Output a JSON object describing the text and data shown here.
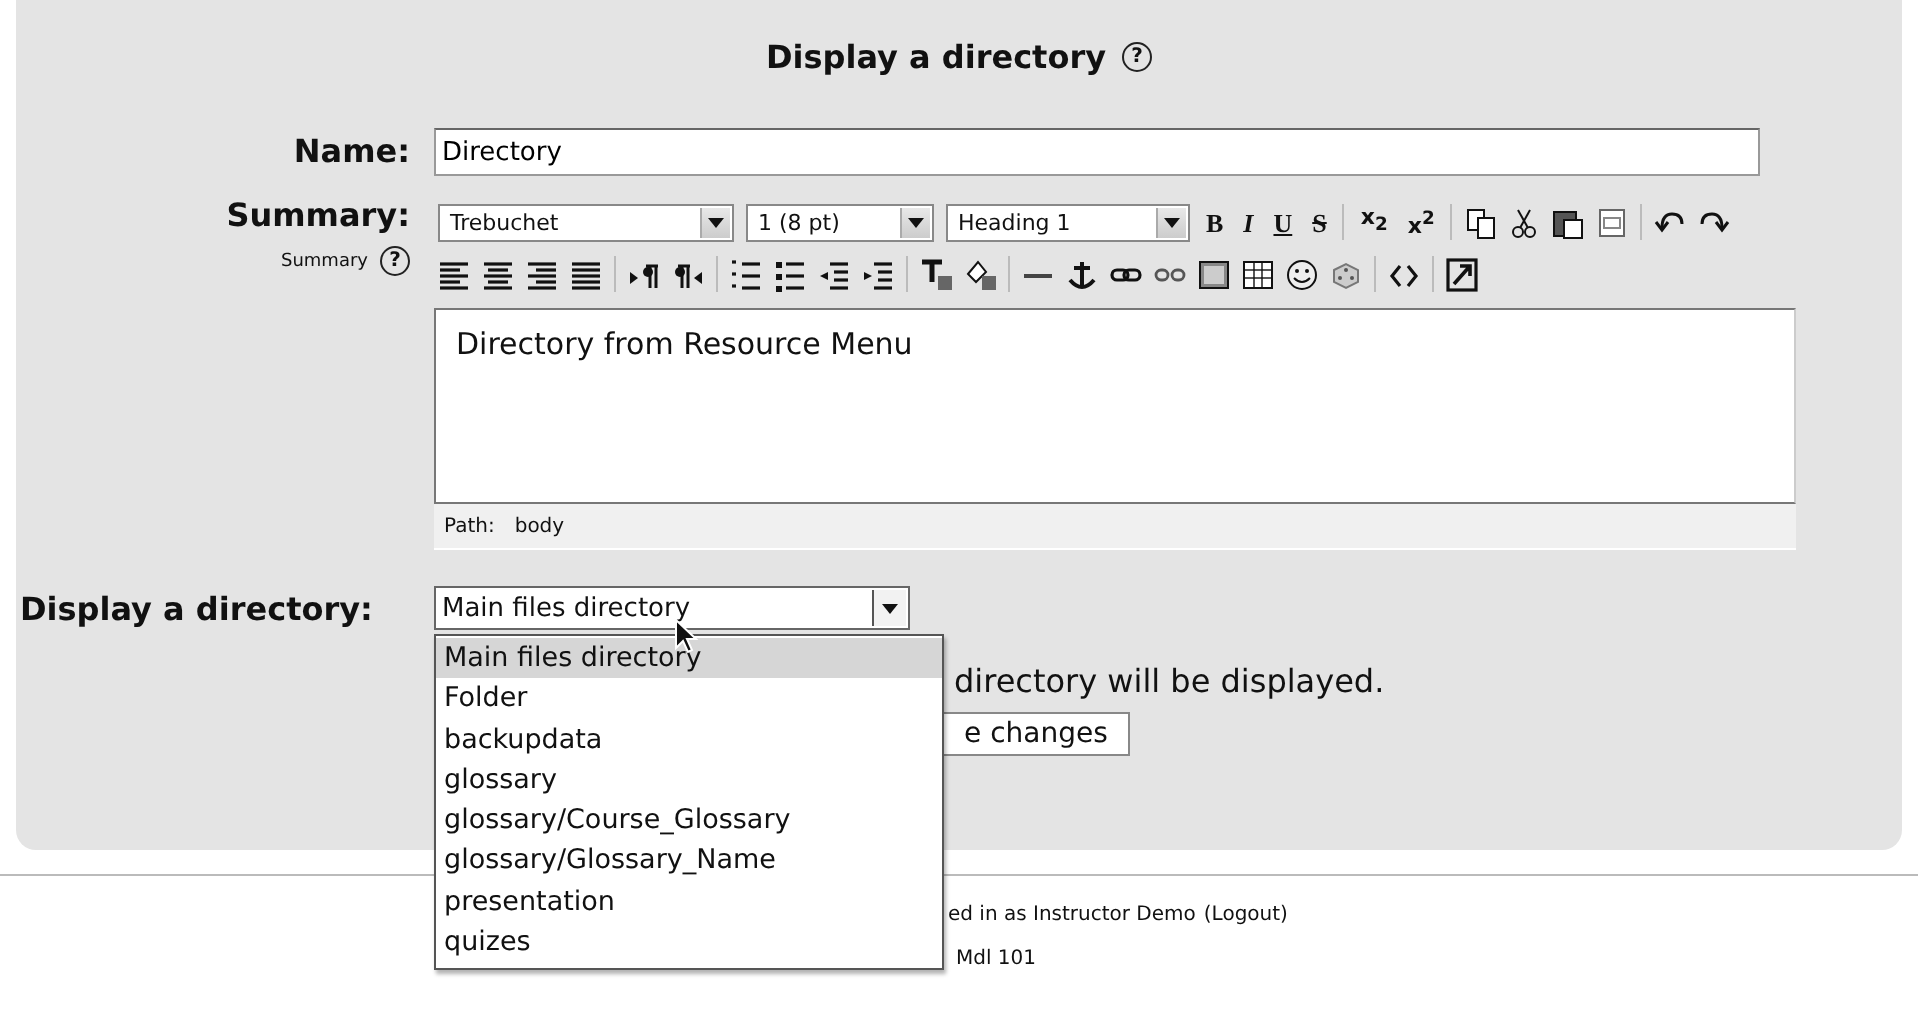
{
  "heading": {
    "title": "Display a directory",
    "help": "?"
  },
  "name_field": {
    "label": "Name:",
    "value": "Directory"
  },
  "summary": {
    "label": "Summary:",
    "sublabel": "Summary",
    "help": "?",
    "toolbar_rows": [
      [
        {
          "kind": "select",
          "value": "Trebuchet"
        },
        {
          "kind": "select",
          "value": "1 (8 pt)"
        },
        {
          "kind": "select",
          "value": "Heading 1"
        },
        {
          "kind": "bold",
          "label": "B"
        },
        {
          "kind": "italic",
          "label": "I"
        },
        {
          "kind": "underline",
          "label": "U"
        },
        {
          "kind": "strike",
          "label": "S"
        },
        {
          "kind": "sep"
        },
        {
          "kind": "glyph",
          "label": "x$_{2}$"
        },
        {
          "kind": "glyph",
          "label": "x$^{2}$"
        },
        {
          "kind": "sep"
        },
        {
          "kind": "copy"
        },
        {
          "kind": "cut"
        },
        {
          "kind": "paste"
        },
        {
          "kind": "word"
        },
        {
          "kind": "sep"
        },
        {
          "kind": "undo"
        },
        {
          "kind": "redo"
        }
      ],
      [
        {
          "kind": "left"
        },
        {
          "kind": "center"
        },
        {
          "kind": "right"
        },
        {
          "kind": "justify"
        },
        {
          "kind": "sep"
        },
        {
          "kind": "ltr"
        },
        {
          "kind": "rtl"
        },
        {
          "kind": "sep"
        },
        {
          "kind": "ol"
        },
        {
          "kind": "ul"
        },
        {
          "kind": "outdent"
        },
        {
          "kind": "indent"
        },
        {
          "kind": "sep"
        },
        {
          "kind": "forecolor"
        },
        {
          "kind": "backcolor"
        },
        {
          "kind": "sep"
        },
        {
          "kind": "rule"
        },
        {
          "kind": "anchor"
        },
        {
          "kind": "link"
        },
        {
          "kind": "unlink"
        },
        {
          "kind": "image"
        },
        {
          "kind": "table"
        },
        {
          "kind": "smiley"
        },
        {
          "kind": "char"
        },
        {
          "kind": "sep"
        },
        {
          "kind": "source"
        },
        {
          "kind": "sep"
        },
        {
          "kind": "fullscreen"
        }
      ]
    ],
    "content": "Directory from Resource Menu",
    "path_label": "Path:",
    "path_value": "body"
  },
  "directory": {
    "label": "Display a directory:",
    "value": "Main files directory",
    "note": "directory will be displayed.",
    "options": [
      {
        "label": "Main files directory",
        "selected": true
      },
      {
        "label": "Folder",
        "selected": false
      },
      {
        "label": "backupdata",
        "selected": false
      },
      {
        "label": "glossary",
        "selected": false
      },
      {
        "label": "glossary/Course_Glossary",
        "selected": false
      },
      {
        "label": "glossary/Glossary_Name",
        "selected": false
      },
      {
        "label": "presentation",
        "selected": false
      },
      {
        "label": "quizes",
        "selected": false
      }
    ]
  },
  "save_button": {
    "label": "e changes"
  },
  "footer": {
    "login_text": "ed in as Instructor Demo",
    "logout_link": "(Logout)",
    "course_link": "Mdl 101"
  }
}
